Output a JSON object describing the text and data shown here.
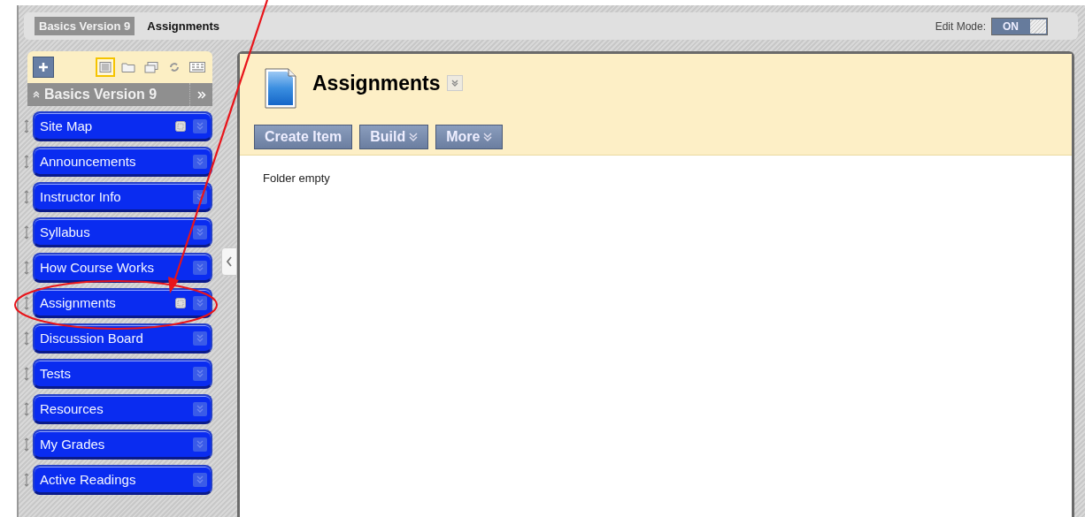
{
  "breadcrumb": [
    {
      "label": "Basics Version 9",
      "kind": "course"
    },
    {
      "label": "Assignments",
      "kind": "page"
    }
  ],
  "edit_mode": {
    "label": "Edit Mode:",
    "value": "ON",
    "on": true
  },
  "sidebar": {
    "tools": [
      {
        "kind": "list",
        "selected": true
      },
      {
        "kind": "folder",
        "selected": false
      },
      {
        "kind": "windows",
        "selected": false
      },
      {
        "kind": "refresh",
        "selected": false
      },
      {
        "kind": "grid",
        "selected": false
      }
    ],
    "course_title": "Basics Version 9",
    "items": [
      {
        "label": "Site Map",
        "hidden_marker": true
      },
      {
        "label": "Announcements",
        "hidden_marker": false
      },
      {
        "label": "Instructor Info",
        "hidden_marker": false
      },
      {
        "label": "Syllabus",
        "hidden_marker": false
      },
      {
        "label": "How Course Works",
        "hidden_marker": false
      },
      {
        "label": "Assignments",
        "hidden_marker": true
      },
      {
        "label": "Discussion Board",
        "hidden_marker": false
      },
      {
        "label": "Tests",
        "hidden_marker": false
      },
      {
        "label": "Resources",
        "hidden_marker": false
      },
      {
        "label": "My Grades",
        "hidden_marker": false
      },
      {
        "label": "Active Readings",
        "hidden_marker": false
      }
    ]
  },
  "content": {
    "title": "Assignments",
    "actions": [
      {
        "label": "Create Item",
        "dropdown": false
      },
      {
        "label": "Build",
        "dropdown": true
      },
      {
        "label": "More",
        "dropdown": true
      }
    ],
    "message": "Folder empty"
  }
}
